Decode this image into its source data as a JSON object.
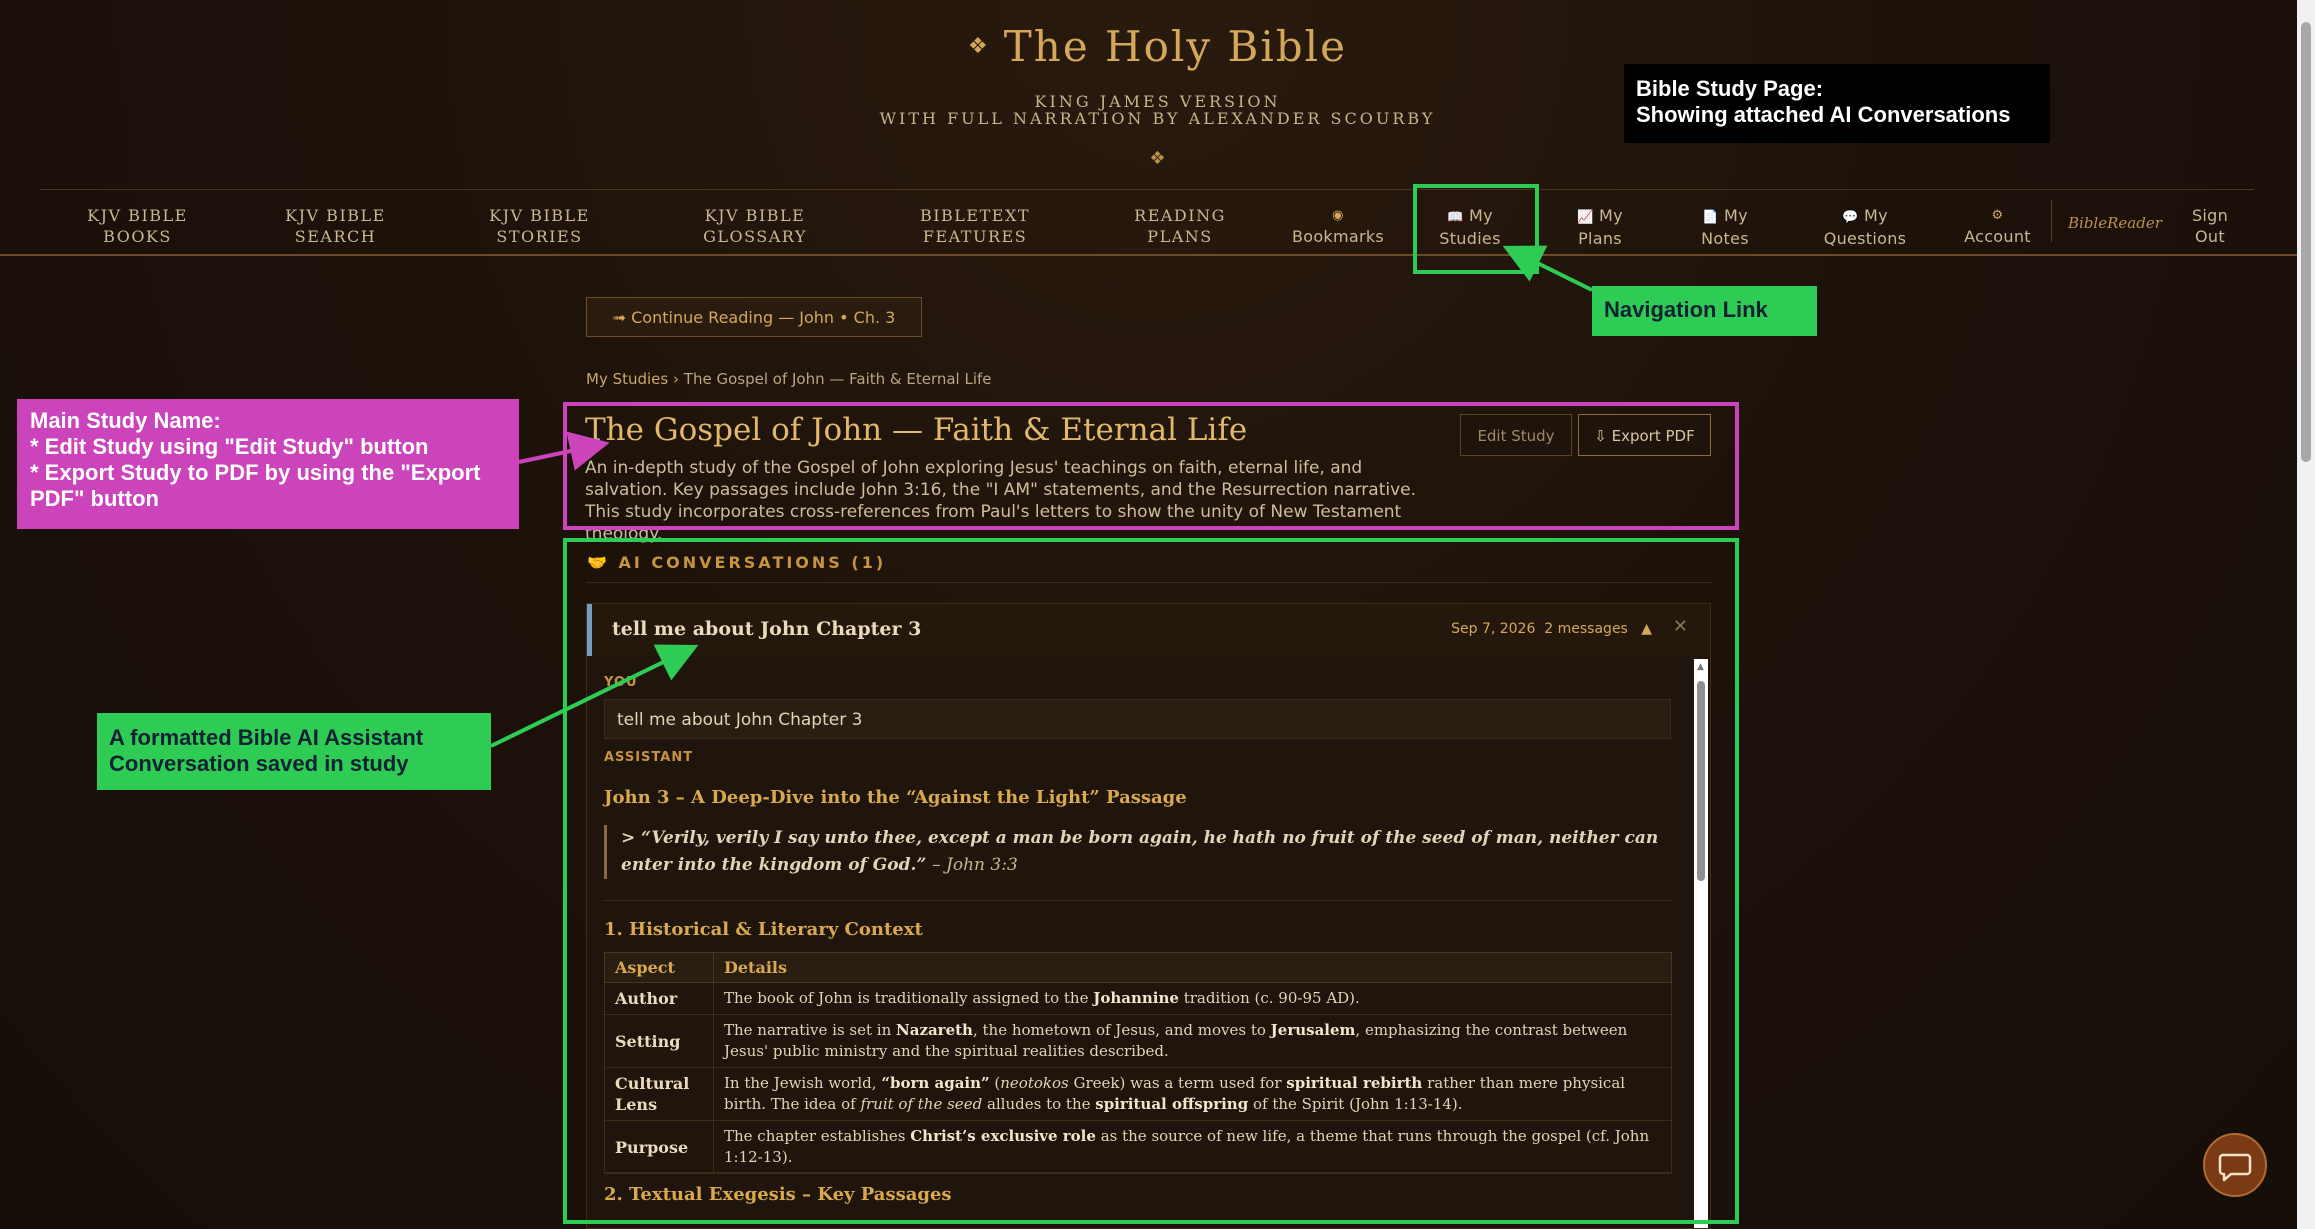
{
  "header": {
    "title": "The Holy Bible",
    "title_ornament": "❖",
    "subtitle_line1": "KING JAMES VERSION",
    "subtitle_line2": "WITH FULL NARRATION BY ALEXANDER SCOURBY",
    "ornament": "❖"
  },
  "nav": {
    "items": [
      {
        "line1": "KJV BIBLE",
        "line2": "BOOKS"
      },
      {
        "line1": "KJV BIBLE",
        "line2": "SEARCH"
      },
      {
        "line1": "KJV BIBLE",
        "line2": "STORIES"
      },
      {
        "line1": "KJV BIBLE",
        "line2": "GLOSSARY"
      },
      {
        "line1": "BIBLETEXT",
        "line2": "FEATURES"
      },
      {
        "line1": "READING",
        "line2": "PLANS"
      },
      {
        "icon": "◉",
        "line2": "Bookmarks"
      },
      {
        "icon": "📖",
        "line1": "My",
        "line2": "Studies"
      },
      {
        "icon": "📈",
        "line1": "My",
        "line2": "Plans"
      },
      {
        "icon": "📄",
        "line1": "My",
        "line2": "Notes"
      },
      {
        "icon": "💬",
        "line1": "My",
        "line2": "Questions"
      },
      {
        "icon": "⚙",
        "line2": "Account"
      },
      {
        "line1": "Sign",
        "line2": "Out"
      }
    ],
    "user": "BibleReader"
  },
  "continue_reading": "➟ Continue Reading — John • Ch. 3",
  "breadcrumb": {
    "root": "My Studies",
    "sep": "›",
    "current": "The Gospel of John — Faith & Eternal Life"
  },
  "study": {
    "title": "The Gospel of John — Faith & Eternal Life",
    "description": "An in-depth study of the Gospel of John exploring Jesus' teachings on faith, eternal life, and salvation. Key passages include John 3:16, the \"I AM\" statements, and the Resurrection narrative. This study incorporates cross-references from Paul's letters to show the unity of New Testament theology.",
    "edit_label": "Edit Study",
    "export_label": "⇩ Export PDF"
  },
  "conversations": {
    "header": "AI CONVERSATIONS (1)",
    "header_icon": "🤝",
    "card": {
      "title": "tell me about John Chapter 3",
      "date": "Sep 7, 2026",
      "messages": "2 messages",
      "toggle": "▲",
      "close": "✕",
      "you_label": "YOU",
      "you_text": "tell me about John Chapter 3",
      "assistant_label": "ASSISTANT",
      "heading": "John 3 – A Deep-Dive into the “Against the Light” Passage",
      "quote": "> “Verily, verily I say unto thee, except a man be born again, he hath no fruit of the seed of man, neither can enter into the kingdom of God.”",
      "quote_ref": "– John 3:3",
      "section1": "1. Historical & Literary Context",
      "table": {
        "headers": [
          "Aspect",
          "Details"
        ],
        "rows": [
          {
            "aspect": "Author",
            "details_html": "The book of John is traditionally assigned to the <b>Johannine</b> tradition (c. 90-95 AD)."
          },
          {
            "aspect": "Setting",
            "details_html": "The narrative is set in <b>Nazareth</b>, the hometown of Jesus, and moves to <b>Jerusalem</b>, emphasizing the contrast between Jesus' public ministry and the spiritual realities described."
          },
          {
            "aspect": "Cultural Lens",
            "details_html": "In the Jewish world, <b>“born again”</b> (<i>neotokos</i> Greek) was a term used for <b>spiritual rebirth</b> rather than mere physical birth. The idea of <i>fruit of the seed</i> alludes to the <b>spiritual offspring</b> of the Spirit (John 1:13-14)."
          },
          {
            "aspect": "Purpose",
            "details_html": "The chapter establishes <b>Christ’s exclusive role</b> as the source of new life, a theme that runs through the gospel (cf. John 1:12-13)."
          }
        ]
      },
      "section2": "2. Textual Exegesis – Key Passages"
    }
  },
  "annotations": {
    "top_right": {
      "line1": "Bible Study Page:",
      "line2": "Showing attached AI Conversations"
    },
    "nav_link": "Navigation Link",
    "study_name": [
      "Main Study Name:",
      "* Edit Study using \"Edit Study\" button",
      "* Export Study to PDF by using the \"Export",
      "PDF\" button"
    ],
    "conversation": [
      "A formatted Bible AI Assistant",
      "Conversation saved in study"
    ]
  },
  "colors": {
    "annotation_green": "#2ecc55",
    "annotation_magenta": "#cc44bb",
    "accent_gold": "#d4a85a"
  }
}
